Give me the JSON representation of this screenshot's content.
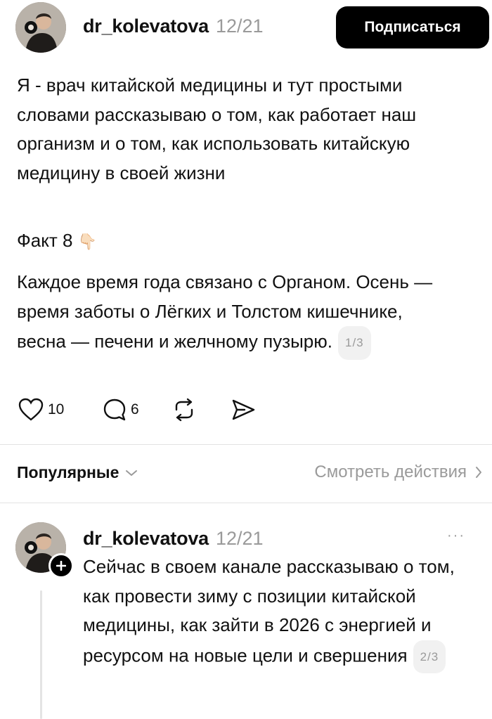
{
  "post": {
    "username": "dr_kolevatova",
    "date": "12/21",
    "subscribe_label": "Подписаться",
    "intro": "Я - врач китайской медицины и тут простыми словами рассказываю о том, как работает наш организм и о том, как использовать китайскую медицину в своей жизни",
    "fact_label": "Факт 8",
    "fact_emoji": "👇🏻",
    "body": "Каждое время года связано с Органом. Осень — время заботы о Лёгких и Толстом кишечнике, весна — печени и желчному пузырю.",
    "page": "1/3",
    "likes": "10",
    "comments": "6"
  },
  "filter_bar": {
    "sort_label": "Популярные",
    "see_actions_label": "Смотреть действия"
  },
  "reply": {
    "username": "dr_kolevatova",
    "date": "12/21",
    "more": "···",
    "body": "Сейчас в своем канале рассказываю о том, как провести зиму с позиции китайской медицины, как зайти в 2026 с энергией и ресурсом на новые цели и свершения",
    "page": "2/3"
  },
  "icons": {
    "like": "heart-icon",
    "comment": "comment-bubble-icon",
    "repost": "repost-icon",
    "share": "send-icon",
    "sort": "chevron-down-icon",
    "see_actions": "chevron-right-icon",
    "add": "plus-icon"
  }
}
